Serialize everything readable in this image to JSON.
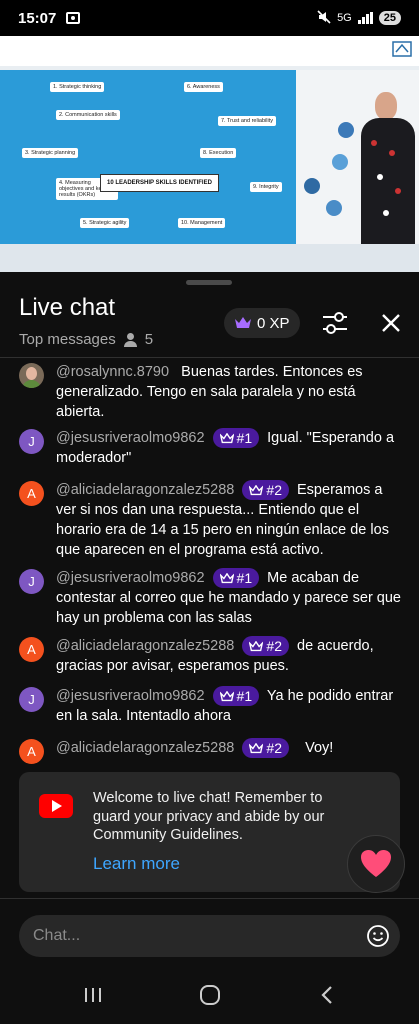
{
  "status_bar": {
    "time": "15:07",
    "network": "5G",
    "battery": "25"
  },
  "video": {
    "infographic_title": "10 LEADERSHIP SKILLS IDENTIFIED",
    "skills": [
      "1. Strategic thinking",
      "2. Communication skills",
      "3. Strategic planning",
      "4. Measuring objectives and key results (OKRs)",
      "5. Strategic agility",
      "6. Awareness",
      "7. Trust and reliability",
      "8. Execution",
      "9. Integrity",
      "10. Management"
    ]
  },
  "header": {
    "title": "Live chat",
    "filter_label": "Top messages",
    "viewer_count": "5",
    "xp_label": "0 XP"
  },
  "messages": [
    {
      "avatar": "",
      "avatar_color": "#7a6a58",
      "username": "@rosalynnc.8790",
      "badge": "",
      "text": "Buenas tardes. Entonces es generalizado. Tengo en sala paralela y no está abierta."
    },
    {
      "avatar": "J",
      "avatar_color": "#7e57c2",
      "username": "@jesusriveraolmo9862",
      "badge": "#1",
      "text": "Igual. \"Esperando a moderador\""
    },
    {
      "avatar": "A",
      "avatar_color": "#f4511e",
      "username": "@aliciadelaragonzalez5288",
      "badge": "#2",
      "text": "Esperamos a ver si nos dan una respuesta... Entiendo que el horario era de 14 a 15 pero en ningún enlace de los que aparecen en el programa está activo."
    },
    {
      "avatar": "J",
      "avatar_color": "#7e57c2",
      "username": "@jesusriveraolmo9862",
      "badge": "#1",
      "text": "Me acaban de contestar al correo que he mandado y parece ser que hay un problema con las salas"
    },
    {
      "avatar": "A",
      "avatar_color": "#f4511e",
      "username": "@aliciadelaragonzalez5288",
      "badge": "#2",
      "text": "de acuerdo, gracias por avisar, esperamos pues."
    },
    {
      "avatar": "J",
      "avatar_color": "#7e57c2",
      "username": "@jesusriveraolmo9862",
      "badge": "#1",
      "text": "Ya he podido entrar en la sala. Intentadlo ahora"
    },
    {
      "avatar": "A",
      "avatar_color": "#f4511e",
      "username": "@aliciadelaragonzalez5288",
      "badge": "#2",
      "text": "Voy!"
    }
  ],
  "welcome": {
    "text": "Welcome to live chat! Remember to guard your privacy and abide by our Community Guidelines.",
    "link": "Learn more"
  },
  "input": {
    "placeholder": "Chat..."
  },
  "colors": {
    "background": "#0f0f0f",
    "link": "#3ea6ff",
    "badge": "#4a1a9e",
    "youtube_red": "#ff0000",
    "heart": "#ff4d79"
  },
  "icons": {
    "filter": "sliders-icon",
    "close": "close-icon",
    "crown": "crown-icon",
    "heart": "heart-icon",
    "emoji": "emoji-icon",
    "viewers": "person-icon"
  }
}
